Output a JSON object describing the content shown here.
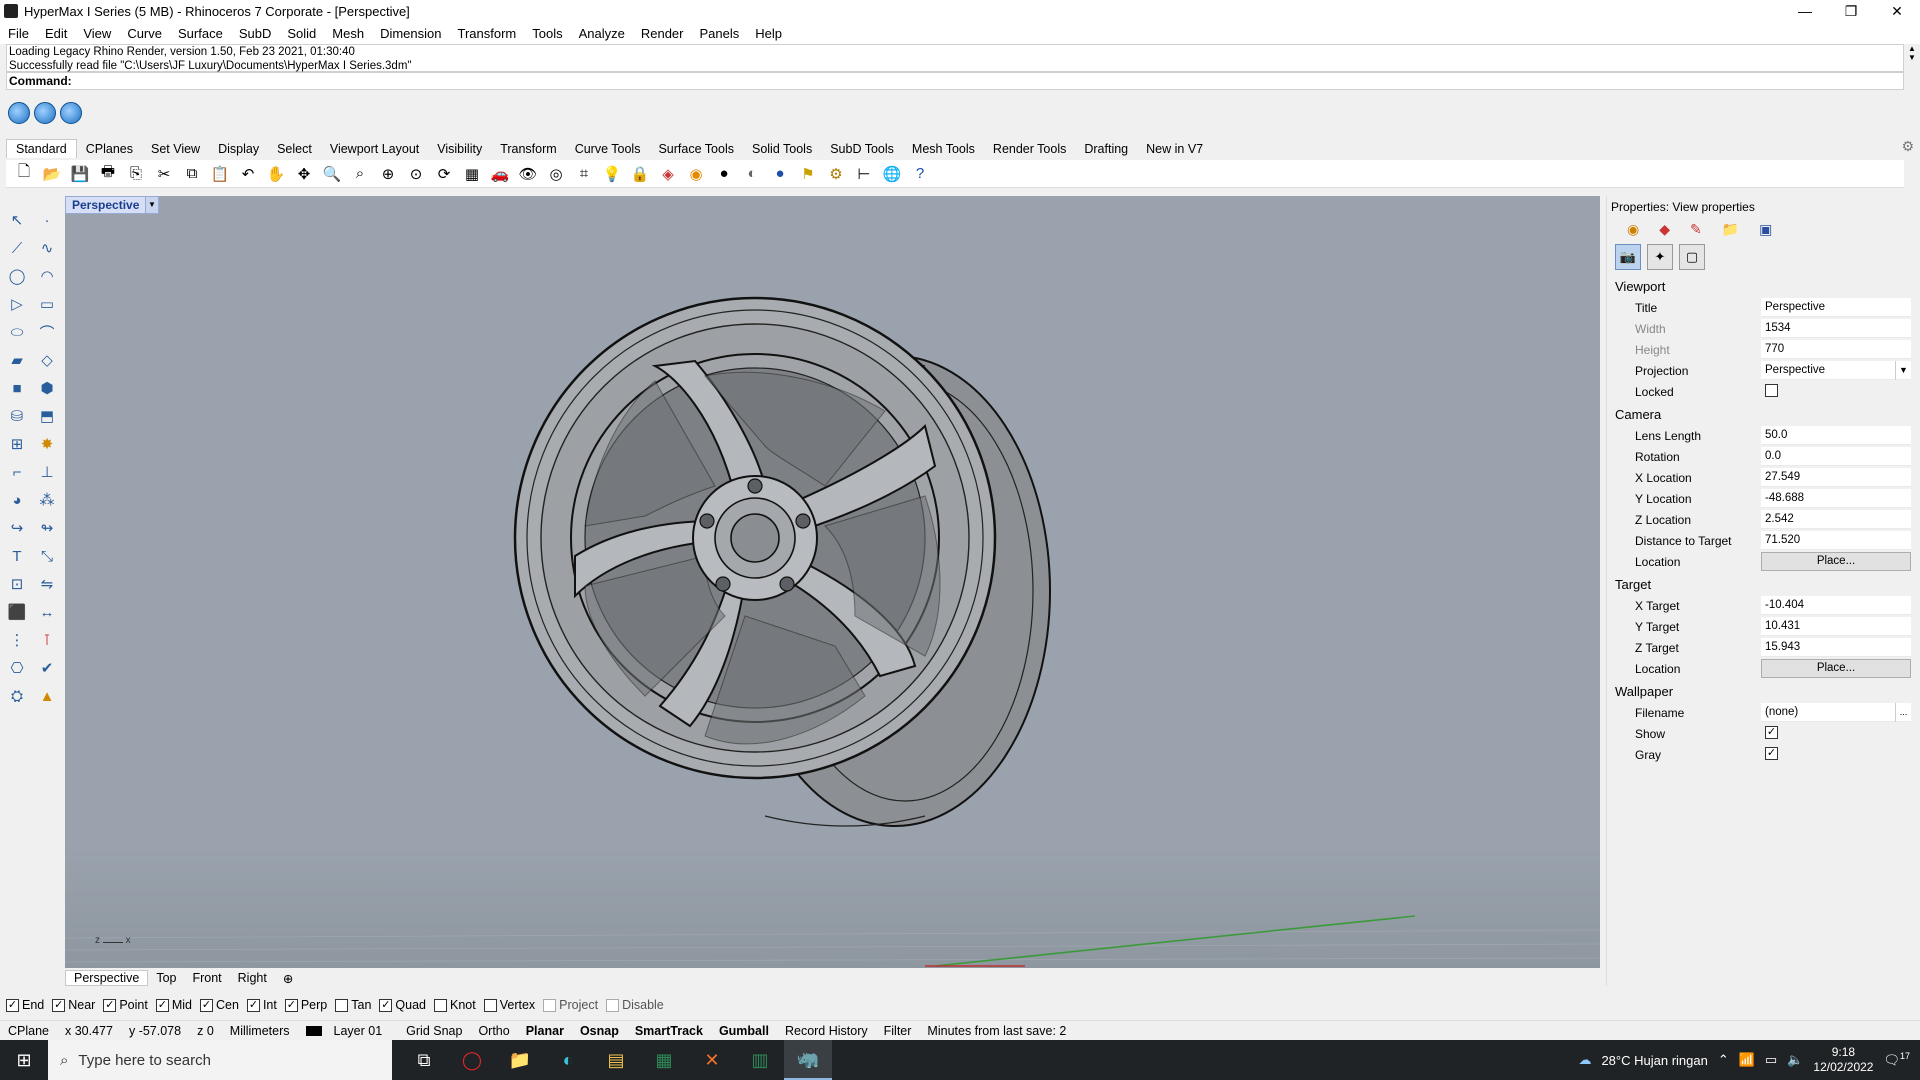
{
  "window": {
    "title": "HyperMax I Series (5 MB) - Rhinoceros 7 Corporate - [Perspective]",
    "minimize": "—",
    "restore": "❐",
    "close": "✕"
  },
  "menu": [
    "File",
    "Edit",
    "View",
    "Curve",
    "Surface",
    "SubD",
    "Solid",
    "Mesh",
    "Dimension",
    "Transform",
    "Tools",
    "Analyze",
    "Render",
    "Panels",
    "Help"
  ],
  "history": {
    "line1": "Loading Legacy Rhino Render, version 1.50, Feb 23 2021, 01:30:40",
    "line2": "Successfully read file \"C:\\Users\\JF Luxury\\Documents\\HyperMax I Series.3dm\""
  },
  "command": {
    "label": "Command:"
  },
  "toolbar_tabs": [
    "Standard",
    "CPlanes",
    "Set View",
    "Display",
    "Select",
    "Viewport Layout",
    "Visibility",
    "Transform",
    "Curve Tools",
    "Surface Tools",
    "Solid Tools",
    "SubD Tools",
    "Mesh Tools",
    "Render Tools",
    "Drafting",
    "New in V7"
  ],
  "toolbar_icons": [
    "new-file-icon",
    "open-icon",
    "save-icon",
    "print-icon",
    "import-icon",
    "cut-icon",
    "copy-icon",
    "paste-icon",
    "undo-icon",
    "pan-icon",
    "move-icon",
    "zoom-icon",
    "zoom-window-icon",
    "zoom-extents-icon",
    "zoom-selected-icon",
    "rotate-view-icon",
    "four-views-icon",
    "car-icon",
    "eye-icon",
    "target-icon",
    "grid-icon",
    "lightbulb-icon",
    "lock-icon",
    "layer-icon",
    "color-wheel-icon",
    "sphere-icon",
    "material-icon",
    "render-sphere-icon",
    "lamp-icon",
    "gears-icon",
    "dimension-icon",
    "globe-icon",
    "help-icon"
  ],
  "viewport": {
    "label": "Perspective",
    "axis_z": "z",
    "axis_x": "x",
    "tabs": [
      "Perspective",
      "Top",
      "Front",
      "Right"
    ]
  },
  "properties": {
    "title": "Properties: View properties",
    "viewport_section": "Viewport",
    "title_label": "Title",
    "title_value": "Perspective",
    "width_label": "Width",
    "width_value": "1534",
    "height_label": "Height",
    "height_value": "770",
    "projection_label": "Projection",
    "projection_value": "Perspective",
    "locked_label": "Locked",
    "camera_section": "Camera",
    "lens_label": "Lens Length",
    "lens_value": "50.0",
    "rotation_label": "Rotation",
    "rotation_value": "0.0",
    "xloc_label": "X Location",
    "xloc_value": "27.549",
    "yloc_label": "Y Location",
    "yloc_value": "-48.688",
    "zloc_label": "Z Location",
    "zloc_value": "2.542",
    "dist_label": "Distance to Target",
    "dist_value": "71.520",
    "location_label": "Location",
    "place_button": "Place...",
    "target_section": "Target",
    "xt_label": "X Target",
    "xt_value": "-10.404",
    "yt_label": "Y Target",
    "yt_value": "10.431",
    "zt_label": "Z Target",
    "zt_value": "15.943",
    "tlocation_label": "Location",
    "wallpaper_section": "Wallpaper",
    "filename_label": "Filename",
    "filename_value": "(none)",
    "browse_button": "...",
    "show_label": "Show",
    "gray_label": "Gray"
  },
  "osnaps": [
    {
      "label": "End",
      "checked": true
    },
    {
      "label": "Near",
      "checked": true
    },
    {
      "label": "Point",
      "checked": true
    },
    {
      "label": "Mid",
      "checked": true
    },
    {
      "label": "Cen",
      "checked": true
    },
    {
      "label": "Int",
      "checked": true
    },
    {
      "label": "Perp",
      "checked": true
    },
    {
      "label": "Tan",
      "checked": false
    },
    {
      "label": "Quad",
      "checked": true
    },
    {
      "label": "Knot",
      "checked": false
    },
    {
      "label": "Vertex",
      "checked": false
    },
    {
      "label": "Project",
      "checked": false
    },
    {
      "label": "Disable",
      "checked": false
    }
  ],
  "status": {
    "cplane": "CPlane",
    "x": "x 30.477",
    "y": "y -57.078",
    "z": "z 0",
    "units": "Millimeters",
    "layer": "Layer 01",
    "grid_snap": "Grid Snap",
    "ortho": "Ortho",
    "planar": "Planar",
    "osnap": "Osnap",
    "smarttrack": "SmartTrack",
    "gumball": "Gumball",
    "record_history": "Record History",
    "filter": "Filter",
    "save_msg": "Minutes from last save: 2"
  },
  "taskbar": {
    "search_placeholder": "Type here to search",
    "weather": "28°C  Hujan ringan",
    "time": "9:18",
    "date": "12/02/2022",
    "notif_count": "17"
  }
}
